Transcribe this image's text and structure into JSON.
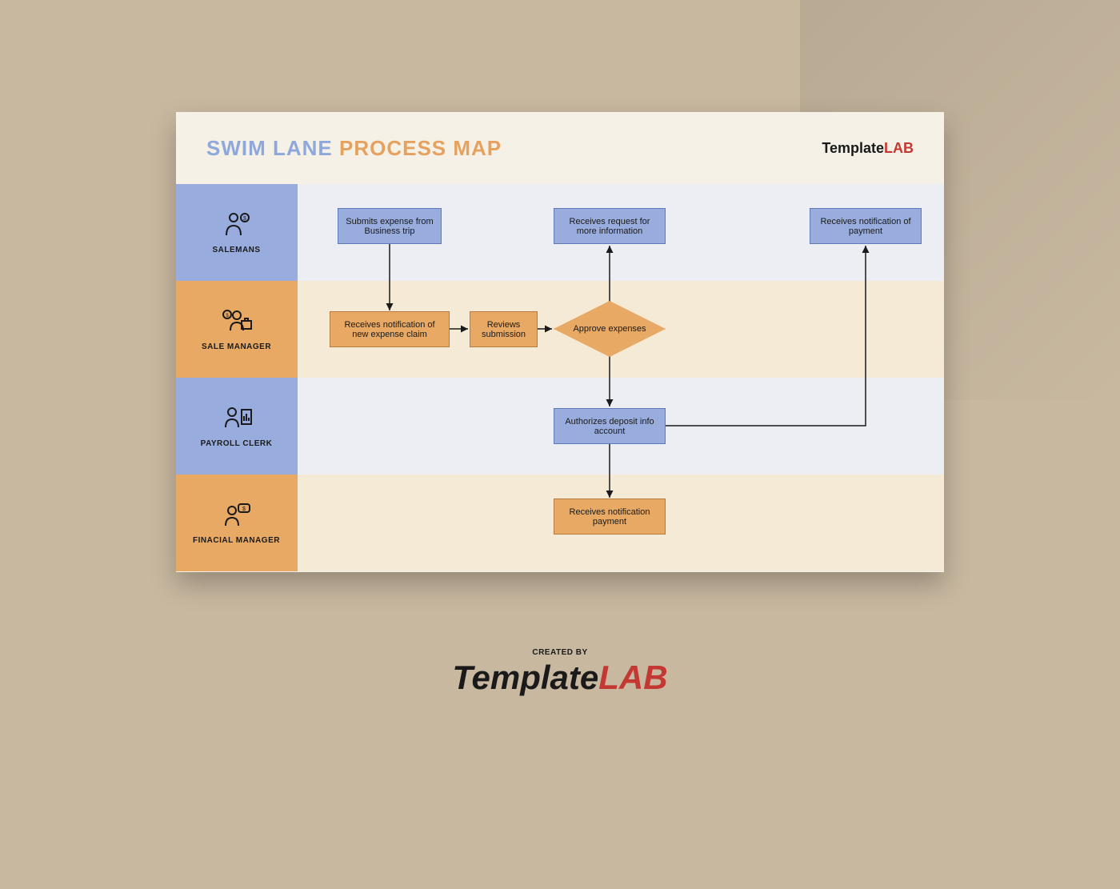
{
  "title": {
    "part1": "SWIM LANE",
    "part2": "PROCESS MAP"
  },
  "brand": {
    "part1": "Template",
    "part2": "LAB"
  },
  "footer": {
    "created": "CREATED BY",
    "part1": "Template",
    "part2": "L",
    "part3": "B"
  },
  "lanes": [
    {
      "label": "SALEMANS",
      "icon": "👤$"
    },
    {
      "label": "SALE MANAGER",
      "icon": "💼$"
    },
    {
      "label": "PAYROLL CLERK",
      "icon": "👤📊"
    },
    {
      "label": "FINACIAL MANAGER",
      "icon": "👤📋"
    }
  ],
  "nodes": {
    "n1": "Submits expense from Business trip",
    "n2": "Receives request for more information",
    "n3": "Receives notification of payment",
    "n4": "Receives notification of new expense claim",
    "n5": "Reviews submission",
    "n6": "Approve expenses",
    "n7": "Authorizes deposit info account",
    "n8": "Receives notification payment"
  },
  "colors": {
    "blue": "#98acde",
    "orange": "#e8a964"
  }
}
